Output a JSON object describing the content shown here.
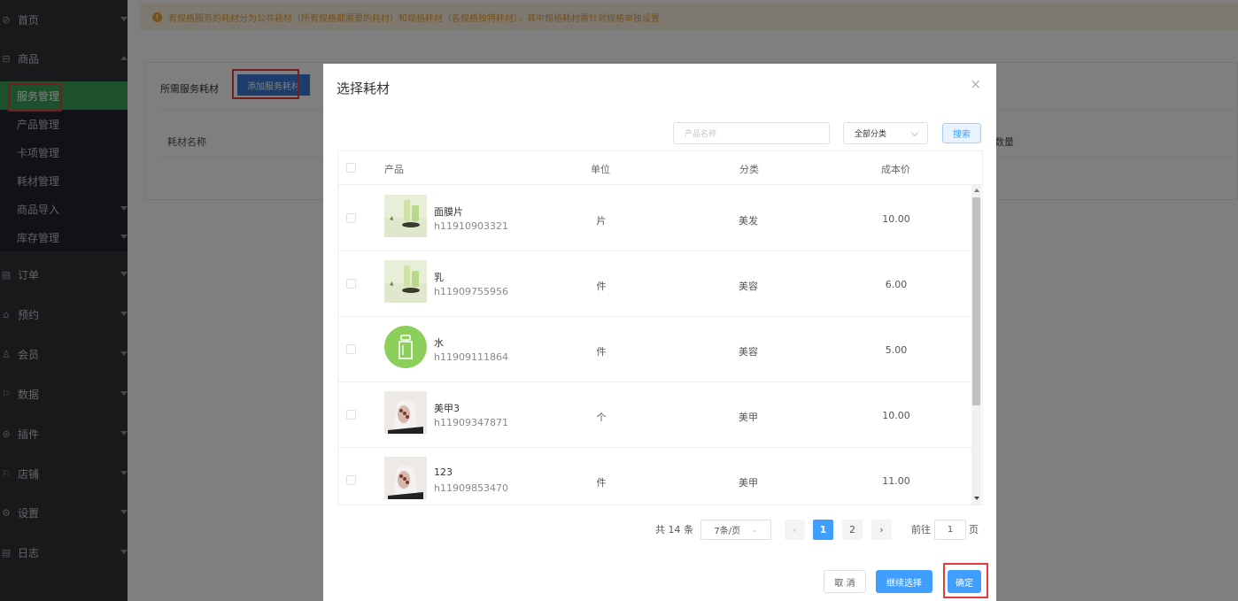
{
  "notice": {
    "text": "有规格服务的耗材分为公共耗材（所有规格都需要的耗材）和规格耗材（各规格独特耗材），其中规格耗材需针对规格单独设置"
  },
  "sidebar": {
    "items": [
      {
        "label": "首页",
        "icon": "home-icon"
      },
      {
        "label": "商品",
        "icon": "goods-icon"
      },
      {
        "label": "订单",
        "icon": "order-icon"
      },
      {
        "label": "预约",
        "icon": "appointment-icon"
      },
      {
        "label": "会员",
        "icon": "member-icon"
      },
      {
        "label": "数据",
        "icon": "data-icon"
      },
      {
        "label": "插件",
        "icon": "plugin-icon"
      },
      {
        "label": "店铺",
        "icon": "shop-icon"
      },
      {
        "label": "设置",
        "icon": "settings-icon"
      },
      {
        "label": "日志",
        "icon": "log-icon"
      }
    ],
    "sub_items": [
      "服务管理",
      "产品管理",
      "卡项管理",
      "耗材管理",
      "商品导入",
      "库存管理"
    ],
    "active_sub": "服务管理"
  },
  "page": {
    "section_label": "所需服务耗材",
    "add_button": "添加服务耗材",
    "col_name": "耗材名称",
    "col_qty": "数量"
  },
  "modal": {
    "title": "选择耗材",
    "close": "×",
    "search_placeholder": "产品名称",
    "category_select": "全部分类",
    "search_button": "搜索",
    "columns": {
      "product": "产品",
      "unit": "单位",
      "category": "分类",
      "cost": "成本价"
    },
    "rows": [
      {
        "name": "面膜片",
        "code": "h11910903321",
        "unit": "片",
        "category": "美发",
        "cost": "10.00",
        "thumb": "skincare-photo"
      },
      {
        "name": "乳",
        "code": "h11909755956",
        "unit": "件",
        "category": "美容",
        "cost": "6.00",
        "thumb": "skincare-photo"
      },
      {
        "name": "水",
        "code": "h11909111864",
        "unit": "件",
        "category": "美容",
        "cost": "5.00",
        "thumb": "bottle-icon"
      },
      {
        "name": "美甲3",
        "code": "h11909347871",
        "unit": "个",
        "category": "美甲",
        "cost": "10.00",
        "thumb": "nail-photo"
      },
      {
        "name": "123",
        "code": "h11909853470",
        "unit": "件",
        "category": "美甲",
        "cost": "11.00",
        "thumb": "nail-photo"
      }
    ],
    "pagination": {
      "total": "共 14 条",
      "page_size": "7条/页",
      "prev": "‹",
      "pages": [
        "1",
        "2"
      ],
      "current": "1",
      "next": "›",
      "goto_label": "前往",
      "goto_value": "1",
      "page_suffix": "页"
    },
    "buttons": {
      "cancel": "取 消",
      "continue": "继续选择",
      "confirm": "确定"
    }
  },
  "colors": {
    "sidebar_bg": "#2f3237",
    "active_green": "#3aa05a",
    "primary_blue": "#409eff",
    "highlight_red": "#e23c3c",
    "notice_orange": "#e6a23c"
  }
}
